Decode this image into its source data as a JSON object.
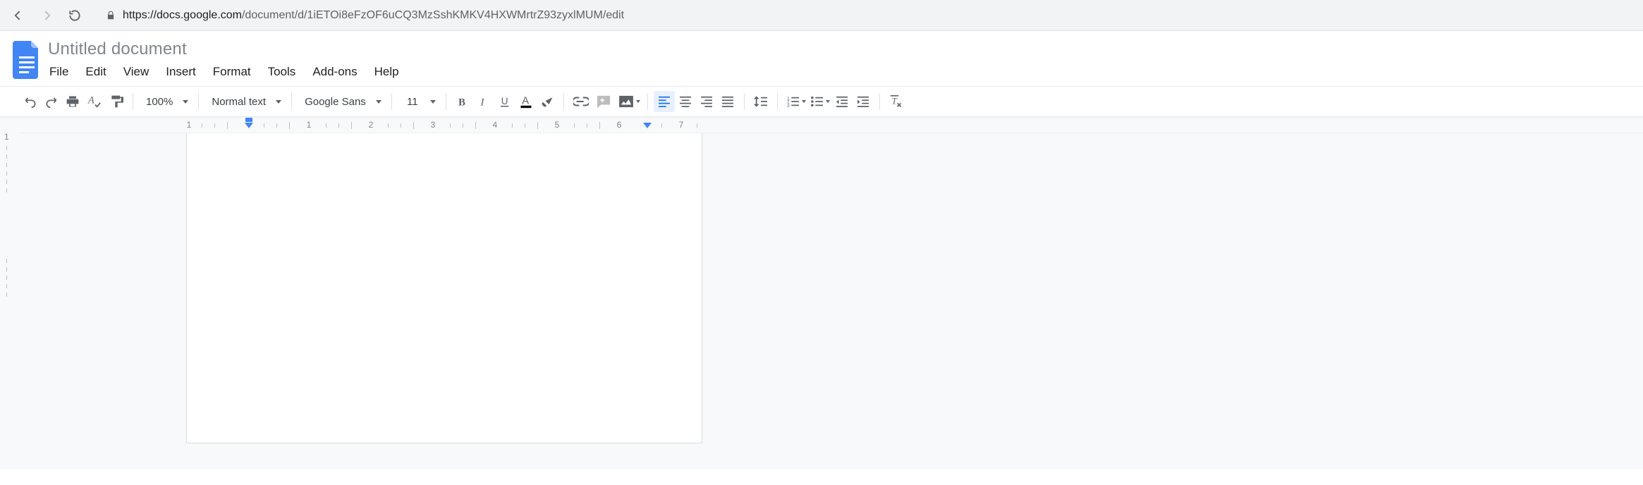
{
  "browser": {
    "url_host": "https://docs.google.com",
    "url_path": "/document/d/1iETOi8eFzOF6uCQ3MzSshKMKV4HXWMrtrZ93zyxlMUM/edit"
  },
  "header": {
    "doc_title": "Untitled document",
    "menu": {
      "file": "File",
      "edit": "Edit",
      "view": "View",
      "insert": "Insert",
      "format": "Format",
      "tools": "Tools",
      "addons": "Add-ons",
      "help": "Help"
    }
  },
  "toolbar": {
    "zoom": "100%",
    "style": "Normal text",
    "font": "Google Sans",
    "size": "11"
  },
  "ruler": {
    "h_marks": [
      "1",
      "1",
      "2",
      "3",
      "4",
      "5",
      "6",
      "7"
    ],
    "v_mark": "1"
  }
}
